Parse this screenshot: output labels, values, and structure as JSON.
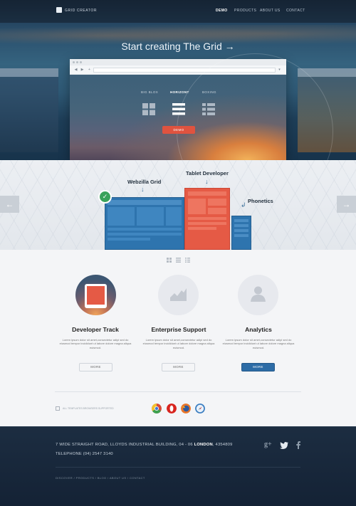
{
  "header": {
    "logo_text": "GRID CREATOR",
    "nav": [
      {
        "label": "DEMO",
        "active": true
      },
      {
        "label": "PRODUCTS",
        "active": false
      },
      {
        "label": "ABOUT US",
        "active": false
      },
      {
        "label": "CONTACT",
        "active": false
      }
    ]
  },
  "hero": {
    "title": "Start creating The Grid →",
    "browser": {
      "back_icon": "back-arrow-icon",
      "forward_icon": "forward-arrow-icon",
      "add_icon": "plus-icon",
      "menu_icon": "chevron-down-icon"
    },
    "layout_options": [
      {
        "label": "BIG BLOX",
        "icon": "grid-blocks-icon",
        "selected": false
      },
      {
        "label": "HORIZONT",
        "icon": "horizontal-rows-icon",
        "selected": true
      },
      {
        "label": "BOXING",
        "icon": "list-boxes-icon",
        "selected": false
      }
    ],
    "demo_button": "DEMO"
  },
  "illustration": {
    "labels": {
      "webzilla": "Webzilla Grid",
      "tablet": "Tablet Developer",
      "phone": "Phonetics"
    },
    "prev_arrow": "←",
    "next_arrow": "→",
    "check": "✓"
  },
  "features": [
    {
      "title": "Developer Track",
      "text": "Lorem ipsum dolor sit amet,consectetur adipi sed do eiusmod tempor incididunt ut labore dolore magna aliqua euismod.",
      "button": "MORE",
      "primary": false
    },
    {
      "title": "Enterprise Support",
      "text": "Lorem ipsum dolor sit amet,consectetur adipi sed do eiusmod tempor incididunt ut labore dolore magna aliqua euismod.",
      "button": "MORE",
      "primary": false
    },
    {
      "title": "Analytics",
      "text": "Lorem ipsum dolor sit amet,consectetur adipi sed do eiusmod tempor incididunt ut labore dolore magna aliqua euismod.",
      "button": "MORE",
      "primary": true
    }
  ],
  "browser_note": "ALL TEMPLATES BROWSERS SUPPORTED",
  "browsers": [
    "chrome-icon",
    "opera-icon",
    "firefox-icon",
    "safari-icon"
  ],
  "footer": {
    "address_pre": "7 WIDE STRAIGHT ROAD,  LLOYDS INDUSTRIAL BUILDING, 04 - 06 ",
    "address_city": "LONDON",
    "address_post": ", 4354809",
    "telephone": "TELEPHONE (04) 2547 3140",
    "social": [
      "g+",
      "twitter-icon",
      "facebook-icon"
    ],
    "links": "DISCOVER  /  PRODUCTS  /  BLOG  /  ABOUT US  /  CONTACT"
  },
  "colors": {
    "accent_red": "#e0533f",
    "accent_blue": "#2d6ca6",
    "footer_bg": "#172538"
  }
}
